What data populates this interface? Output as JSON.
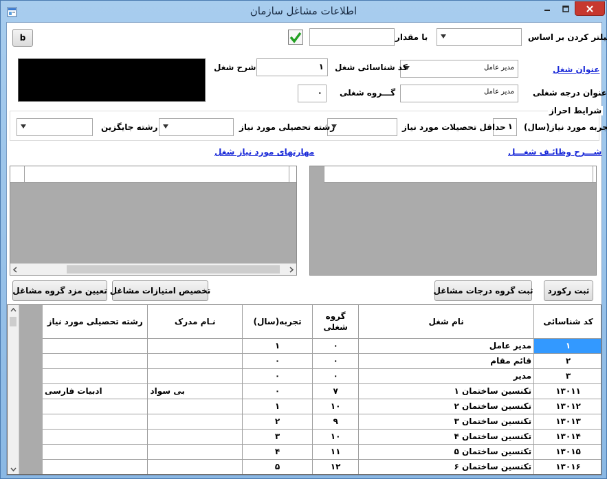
{
  "window": {
    "title": "اطلاعات مشاغل سازمان"
  },
  "filter": {
    "label": "فیلتر کردن بر اساس",
    "field_value": "",
    "value_label": "با مقدار",
    "value_input": "",
    "b_button": "b"
  },
  "job": {
    "title_link": "عنوان شغل",
    "title_value": "مدیر عامل",
    "id_label": "کد شناسائی شغل",
    "id_value": "۱",
    "desc_label": "شرح شغل",
    "grade_title_label": "عنوان درجه شغلی",
    "grade_title_value": "مدیر عامل",
    "group_label": "گـــروه شغلی",
    "group_value": "۰"
  },
  "requirements": {
    "section_label": "شرایط احراز",
    "experience_label": "تجربه مورد نیاز(سال)",
    "experience_value": "۱",
    "min_education_label": "حداقل تحصیلات مورد نیاز",
    "min_education_value": "",
    "field_label": "رشته تحصیلی مورد نیاز",
    "field_value": "",
    "alt_field_label": "رشته جایگزین",
    "alt_field_value": ""
  },
  "links": {
    "duties": "شـــرح وظائـف شغـــل",
    "skills": "مهارتهای مورد نیاز شغل"
  },
  "buttons": {
    "save": "ثبت رکورد",
    "save_grades": "ثبت گروه درجات مشاغل",
    "assign_points": "تخصیص امتیازات مشاغل",
    "set_wage": "تعیین مزد گروه مشاغل"
  },
  "table": {
    "headers": {
      "id": "کد شناسائی",
      "name": "نام شغل",
      "group": "گروه شغلی",
      "experience": "تجربه(سال)",
      "degree": "نـام مدرک",
      "field": "رشته تحصیلی مورد نیاز"
    },
    "rows": [
      {
        "id": "۱",
        "name": "مدیر عامل",
        "group": "۰",
        "experience": "۱",
        "degree": "",
        "field": ""
      },
      {
        "id": "۲",
        "name": "قائم مقام",
        "group": "۰",
        "experience": "۰",
        "degree": "",
        "field": ""
      },
      {
        "id": "۳",
        "name": "مدیر",
        "group": "۰",
        "experience": "۰",
        "degree": "",
        "field": ""
      },
      {
        "id": "۱۳۰۱۱",
        "name": "تکنسین ساختمان ۱",
        "group": "۷",
        "experience": "۰",
        "degree": "بی سواد",
        "field": "ادبیات فارسی"
      },
      {
        "id": "۱۳۰۱۲",
        "name": "تکنسین ساختمان ۲",
        "group": "۱۰",
        "experience": "۱",
        "degree": "",
        "field": ""
      },
      {
        "id": "۱۳۰۱۳",
        "name": "تکنسین ساختمان ۳",
        "group": "۹",
        "experience": "۲",
        "degree": "",
        "field": ""
      },
      {
        "id": "۱۳۰۱۴",
        "name": "تکنسین ساختمان ۴",
        "group": "۱۰",
        "experience": "۳",
        "degree": "",
        "field": ""
      },
      {
        "id": "۱۳۰۱۵",
        "name": "تکنسین ساختمان ۵",
        "group": "۱۱",
        "experience": "۴",
        "degree": "",
        "field": ""
      },
      {
        "id": "۱۳۰۱۶",
        "name": "تکنسین ساختمان ۶",
        "group": "۱۲",
        "experience": "۵",
        "degree": "",
        "field": ""
      }
    ]
  },
  "colors": {
    "selection": "#3399ff",
    "link": "#1a2ad8",
    "close": "#c7382f",
    "titlebar": "#a8cdee"
  }
}
